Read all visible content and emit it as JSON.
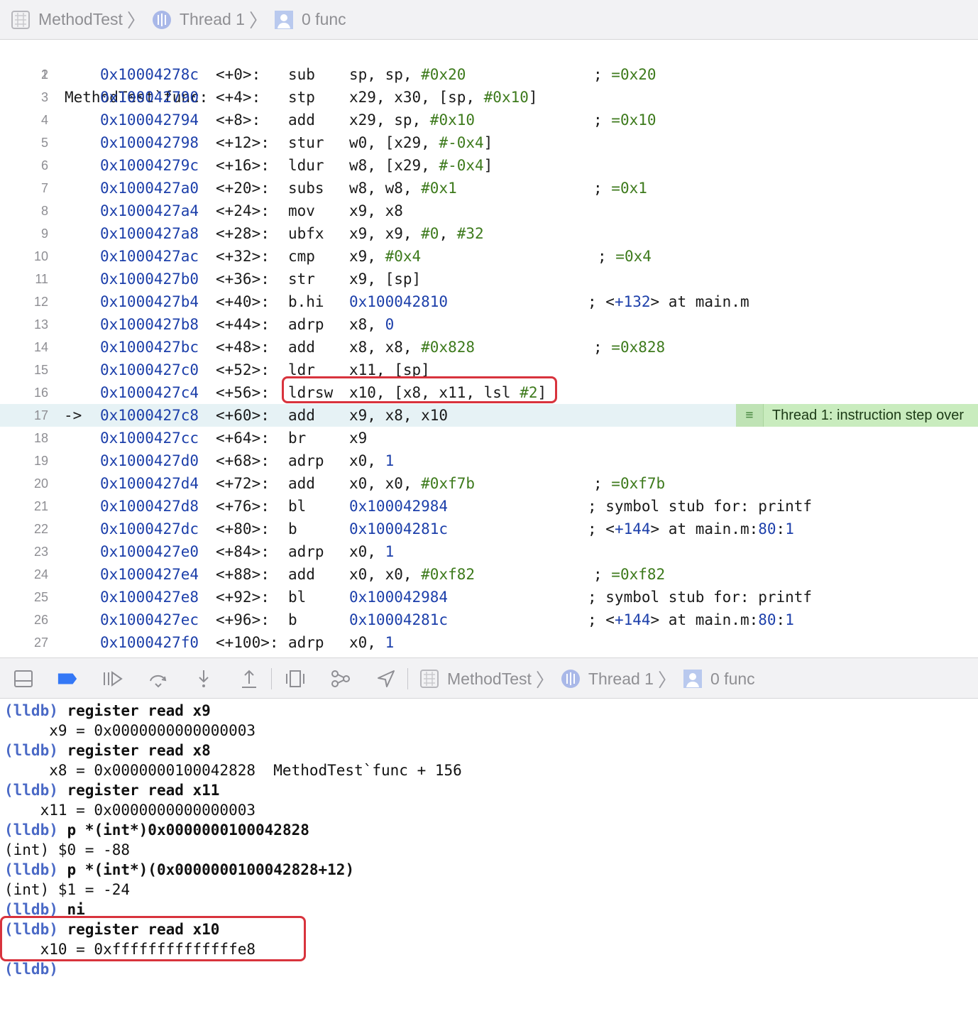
{
  "breadcrumb": {
    "items": [
      {
        "label": "MethodTest",
        "icon": "project-icon"
      },
      {
        "label": "Thread 1",
        "icon": "thread-icon"
      },
      {
        "label": "0 func",
        "icon": "frame-user-icon"
      }
    ]
  },
  "disassembly": {
    "label_line": {
      "num": "1",
      "text": "MethodTest`func:"
    },
    "rows": [
      {
        "num": "2",
        "addr": "0x10004278c",
        "off": "<+0>:",
        "mn": "sub",
        "ops": [
          [
            "sp, sp, ",
            ""
          ],
          [
            "#0x20",
            "g"
          ]
        ],
        "comment": [
          [
            "; ",
            ""
          ],
          [
            "=0x20",
            "g"
          ]
        ],
        "ccol": "g"
      },
      {
        "num": "3",
        "addr": "0x100042790",
        "off": "<+4>:",
        "mn": "stp",
        "ops": [
          [
            "x29, x30, [sp, ",
            ""
          ],
          [
            "#0x10",
            "g"
          ],
          [
            "]",
            ""
          ]
        ],
        "comment": []
      },
      {
        "num": "4",
        "addr": "0x100042794",
        "off": "<+8>:",
        "mn": "add",
        "ops": [
          [
            "x29, sp, ",
            ""
          ],
          [
            "#0x10",
            "g"
          ]
        ],
        "comment": [
          [
            "; ",
            ""
          ],
          [
            "=0x10",
            "g"
          ]
        ]
      },
      {
        "num": "5",
        "addr": "0x100042798",
        "off": "<+12>:",
        "mn": "stur",
        "ops": [
          [
            "w0, [x29, ",
            ""
          ],
          [
            "#-0x4",
            "g"
          ],
          [
            "]",
            ""
          ]
        ],
        "comment": []
      },
      {
        "num": "6",
        "addr": "0x10004279c",
        "off": "<+16>:",
        "mn": "ldur",
        "ops": [
          [
            "w8, [x29, ",
            ""
          ],
          [
            "#-0x4",
            "g"
          ],
          [
            "]",
            ""
          ]
        ],
        "comment": []
      },
      {
        "num": "7",
        "addr": "0x1000427a0",
        "off": "<+20>:",
        "mn": "subs",
        "ops": [
          [
            "w8, w8, ",
            ""
          ],
          [
            "#0x1",
            "g"
          ]
        ],
        "comment": [
          [
            "; ",
            ""
          ],
          [
            "=0x1",
            "g"
          ]
        ]
      },
      {
        "num": "8",
        "addr": "0x1000427a4",
        "off": "<+24>:",
        "mn": "mov",
        "ops": [
          [
            "x9, x8",
            ""
          ]
        ],
        "comment": []
      },
      {
        "num": "9",
        "addr": "0x1000427a8",
        "off": "<+28>:",
        "mn": "ubfx",
        "ops": [
          [
            "x9, x9, ",
            ""
          ],
          [
            "#0",
            "g"
          ],
          [
            ", ",
            ""
          ],
          [
            "#32",
            "g"
          ]
        ],
        "comment": []
      },
      {
        "num": "10",
        "addr": "0x1000427ac",
        "off": "<+32>:",
        "mn": "cmp",
        "ops": [
          [
            "x9, ",
            ""
          ],
          [
            "#0x4",
            "g"
          ]
        ],
        "comment": [
          [
            "; ",
            ""
          ],
          [
            "=0x4",
            "g"
          ]
        ]
      },
      {
        "num": "11",
        "addr": "0x1000427b0",
        "off": "<+36>:",
        "mn": "str",
        "ops": [
          [
            "x9, [sp]",
            ""
          ]
        ],
        "comment": []
      },
      {
        "num": "12",
        "addr": "0x1000427b4",
        "off": "<+40>:",
        "mn": "b.hi",
        "ops": [
          [
            "0x100042810",
            "b"
          ]
        ],
        "comment": [
          [
            "; <",
            ""
          ],
          [
            "+132",
            "b"
          ],
          [
            "> at main.m",
            ""
          ]
        ]
      },
      {
        "num": "13",
        "addr": "0x1000427b8",
        "off": "<+44>:",
        "mn": "adrp",
        "ops": [
          [
            "x8, ",
            ""
          ],
          [
            "0",
            "b"
          ]
        ],
        "comment": []
      },
      {
        "num": "14",
        "addr": "0x1000427bc",
        "off": "<+48>:",
        "mn": "add",
        "ops": [
          [
            "x8, x8, ",
            ""
          ],
          [
            "#0x828",
            "g"
          ]
        ],
        "comment": [
          [
            "; ",
            ""
          ],
          [
            "=0x828",
            "g"
          ]
        ]
      },
      {
        "num": "15",
        "addr": "0x1000427c0",
        "off": "<+52>:",
        "mn": "ldr",
        "ops": [
          [
            "x11, [sp]",
            ""
          ]
        ],
        "comment": []
      },
      {
        "num": "16",
        "addr": "0x1000427c4",
        "off": "<+56>:",
        "mn": "ldrsw",
        "ops": [
          [
            "x10, [x8, x11, lsl ",
            ""
          ],
          [
            "#2",
            "g"
          ],
          [
            "]",
            ""
          ]
        ],
        "comment": []
      },
      {
        "num": "17",
        "arrow": "->",
        "addr": "0x1000427c8",
        "off": "<+60>:",
        "mn": "add",
        "ops": [
          [
            "x9, x8, x10",
            ""
          ]
        ],
        "comment": [],
        "current": true
      },
      {
        "num": "18",
        "addr": "0x1000427cc",
        "off": "<+64>:",
        "mn": "br",
        "ops": [
          [
            "x9",
            ""
          ]
        ],
        "comment": []
      },
      {
        "num": "19",
        "addr": "0x1000427d0",
        "off": "<+68>:",
        "mn": "adrp",
        "ops": [
          [
            "x0, ",
            ""
          ],
          [
            "1",
            "b"
          ]
        ],
        "comment": []
      },
      {
        "num": "20",
        "addr": "0x1000427d4",
        "off": "<+72>:",
        "mn": "add",
        "ops": [
          [
            "x0, x0, ",
            ""
          ],
          [
            "#0xf7b",
            "g"
          ]
        ],
        "comment": [
          [
            "; ",
            ""
          ],
          [
            "=0xf7b",
            "g"
          ]
        ]
      },
      {
        "num": "21",
        "addr": "0x1000427d8",
        "off": "<+76>:",
        "mn": "bl",
        "ops": [
          [
            "0x100042984",
            "b"
          ]
        ],
        "comment": [
          [
            "; symbol stub for: printf",
            ""
          ]
        ]
      },
      {
        "num": "22",
        "addr": "0x1000427dc",
        "off": "<+80>:",
        "mn": "b",
        "ops": [
          [
            "0x10004281c",
            "b"
          ]
        ],
        "comment": [
          [
            "; <",
            ""
          ],
          [
            "+144",
            "b"
          ],
          [
            "> at main.m:",
            ""
          ],
          [
            "80",
            "b"
          ],
          [
            ":",
            ""
          ],
          [
            "1",
            "b"
          ]
        ]
      },
      {
        "num": "23",
        "addr": "0x1000427e0",
        "off": "<+84>:",
        "mn": "adrp",
        "ops": [
          [
            "x0, ",
            ""
          ],
          [
            "1",
            "b"
          ]
        ],
        "comment": []
      },
      {
        "num": "24",
        "addr": "0x1000427e4",
        "off": "<+88>:",
        "mn": "add",
        "ops": [
          [
            "x0, x0, ",
            ""
          ],
          [
            "#0xf82",
            "g"
          ]
        ],
        "comment": [
          [
            "; ",
            ""
          ],
          [
            "=0xf82",
            "g"
          ]
        ]
      },
      {
        "num": "25",
        "addr": "0x1000427e8",
        "off": "<+92>:",
        "mn": "bl",
        "ops": [
          [
            "0x100042984",
            "b"
          ]
        ],
        "comment": [
          [
            "; symbol stub for: printf",
            ""
          ]
        ]
      },
      {
        "num": "26",
        "addr": "0x1000427ec",
        "off": "<+96>:",
        "mn": "b",
        "ops": [
          [
            "0x10004281c",
            "b"
          ]
        ],
        "comment": [
          [
            "; <",
            ""
          ],
          [
            "+144",
            "b"
          ],
          [
            "> at main.m:",
            ""
          ],
          [
            "80",
            "b"
          ],
          [
            ":",
            ""
          ],
          [
            "1",
            "b"
          ]
        ]
      },
      {
        "num": "27",
        "addr": "0x1000427f0",
        "off": "<+100>:",
        "mn": "adrp",
        "ops": [
          [
            "x0, ",
            ""
          ],
          [
            "1",
            "b"
          ]
        ],
        "comment": []
      }
    ],
    "thread_badge": "Thread 1: instruction step over"
  },
  "debug_toolbar": {
    "buttons": [
      "hide-debug-area-icon",
      "breakpoints-toggle-icon",
      "continue-icon",
      "step-over-icon",
      "step-into-icon",
      "step-out-icon",
      "view-hierarchy-icon",
      "memory-graph-icon",
      "simulate-location-icon"
    ],
    "breadcrumb": [
      {
        "label": "MethodTest",
        "icon": "project-icon"
      },
      {
        "label": "Thread 1",
        "icon": "thread-icon"
      },
      {
        "label": "0 func",
        "icon": "frame-user-icon"
      }
    ]
  },
  "console": {
    "lines": [
      {
        "type": "cmd",
        "prompt": "(lldb)",
        "text": "register read x9"
      },
      {
        "type": "out",
        "text": "     x9 = 0x0000000000000003"
      },
      {
        "type": "cmd",
        "prompt": "(lldb)",
        "text": "register read x8"
      },
      {
        "type": "out",
        "text": "     x8 = 0x0000000100042828  MethodTest`func + 156"
      },
      {
        "type": "cmd",
        "prompt": "(lldb)",
        "text": "register read x11"
      },
      {
        "type": "out",
        "text": "    x11 = 0x0000000000000003"
      },
      {
        "type": "cmd",
        "prompt": "(lldb)",
        "text": "p *(int*)0x0000000100042828"
      },
      {
        "type": "out",
        "text": "(int) $0 = -88"
      },
      {
        "type": "cmd",
        "prompt": "(lldb)",
        "text": "p *(int*)(0x0000000100042828+12)"
      },
      {
        "type": "out",
        "text": "(int) $1 = -24"
      },
      {
        "type": "cmd",
        "prompt": "(lldb)",
        "text": "ni"
      },
      {
        "type": "cmd",
        "prompt": "(lldb)",
        "text": "register read x10"
      },
      {
        "type": "out",
        "text": "    x10 = 0xffffffffffffffe8"
      },
      {
        "type": "cmd",
        "prompt": "(lldb)",
        "text": ""
      }
    ]
  },
  "colors": {
    "accent": "#1c3faa",
    "immediate": "#3d7a1c",
    "prompt": "#4a69c6",
    "highlight": "#d8333d",
    "current_line": "#e6f2f5",
    "badge": "#c9ecbe"
  }
}
